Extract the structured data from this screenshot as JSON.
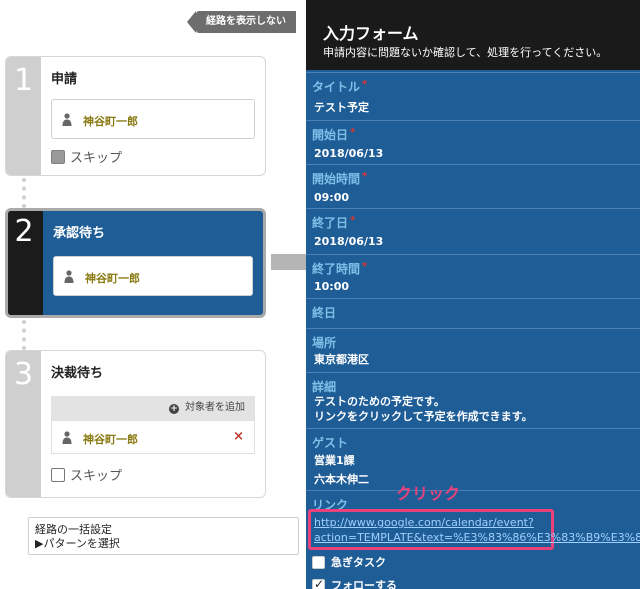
{
  "left": {
    "hide_route_label": "経路を表示しない",
    "steps": [
      {
        "num": "1",
        "title": "申請",
        "user": "神谷町一郎",
        "skip_label": "スキップ"
      },
      {
        "num": "2",
        "title": "承認待ち",
        "user": "神谷町一郎"
      },
      {
        "num": "3",
        "title": "決裁待ち",
        "add_target_label": "対象者を追加",
        "user": "神谷町一郎",
        "delete_mark": "×",
        "skip_label": "スキップ"
      }
    ],
    "bulk": {
      "title": "経路の一括設定",
      "pattern_label": "▶パターンを選択"
    }
  },
  "form": {
    "title": "入力フォーム",
    "description": "申請内容に問題ないか確認して、処理を行ってください。",
    "required_mark": "*",
    "fields": [
      {
        "label": "タイトル",
        "value": "テスト予定"
      },
      {
        "label": "開始日",
        "value": "2018/06/13"
      },
      {
        "label": "開始時間",
        "value": "09:00"
      },
      {
        "label": "終了日",
        "value": "2018/06/13"
      },
      {
        "label": "終了時間",
        "value": "10:00"
      },
      {
        "label": "終日",
        "value": ""
      },
      {
        "label": "場所",
        "value": "東京都港区"
      },
      {
        "label": "詳細",
        "line1": "テストのための予定です。",
        "line2": "リンクをクリックして予定を作成できます。"
      },
      {
        "label": "ゲスト",
        "line1": "営業1課",
        "line2": "六本木伸二"
      },
      {
        "label": "リンク",
        "line1": "http://www.google.com/calendar/event?",
        "line2": "action=TEMPLATE&text=%E3%83%86%E3%83%B9%E3%83%8"
      }
    ],
    "click_note": "クリック",
    "checks": [
      {
        "label": "急ぎタスク",
        "checked": false
      },
      {
        "label": "フォローする",
        "checked": true
      }
    ]
  },
  "colors": {
    "panel_blue": "#1f5d97",
    "label_blue": "#7fbfe8",
    "highlight_pink": "#e8417b"
  }
}
